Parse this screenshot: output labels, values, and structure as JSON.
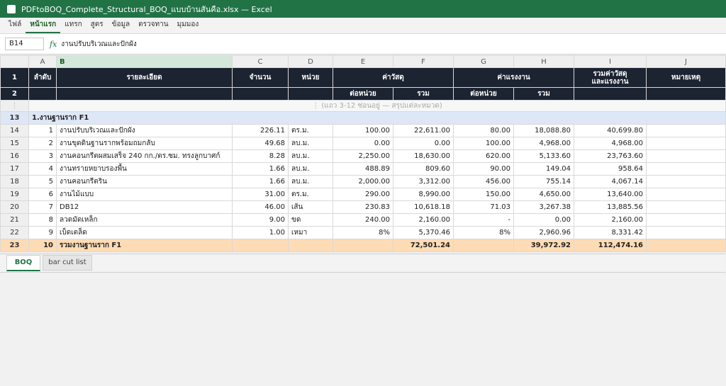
{
  "app": {
    "title": "PDFtoBOQ_Complete_Structural_BOQ_แบบบ้านสันคือ.xlsx — Excel"
  },
  "ribbon": {
    "tabs": [
      "ไฟล์",
      "หน้าแรก",
      "แทรก",
      "สูตร",
      "ข้อมูล",
      "ตรวจทาน",
      "มุมมอง"
    ]
  },
  "formula_bar": {
    "cell": "B14",
    "fx": "fx",
    "content": "งานปรับบริเวณและปักผัง"
  },
  "columns": [
    "A",
    "B",
    "C",
    "D",
    "E",
    "F",
    "G",
    "H",
    "I",
    "J"
  ],
  "header": {
    "row1": "1",
    "row2": "2",
    "a": "ลำดับ",
    "b": "รายละเอียด",
    "c": "จำนวน",
    "d": "หน่วย",
    "material": "ค่าวัสดุ",
    "labor": "ค่าแรงงาน",
    "total_l1": "รวมค่าวัสดุ",
    "total_l2": "และแรงงาน",
    "remark": "หมายเหตุ",
    "unit_price": "ต่อหน่วย",
    "sum": "รวม"
  },
  "gap": {
    "dots": "⋮",
    "note": "⋮ (แถว 3-12 ซ่อนอยู่ — สรุปแต่ละหมวด)"
  },
  "section": {
    "row": "13",
    "label": "1.งานฐานราก F1"
  },
  "rows": [
    {
      "r": "14",
      "a": "1",
      "b": "งานปรับบริเวณและปักผัง",
      "c": "226.11",
      "d": "ตร.ม.",
      "e": "100.00",
      "f": "22,611.00",
      "g": "80.00",
      "h": "18,088.80",
      "i": "40,699.80"
    },
    {
      "r": "15",
      "a": "2",
      "b": "งานขุดดินฐานรากพร้อมถมกลับ",
      "c": "49.68",
      "d": "ลบ.ม.",
      "e": "0.00",
      "f": "0.00",
      "g": "100.00",
      "h": "4,968.00",
      "i": "4,968.00"
    },
    {
      "r": "16",
      "a": "3",
      "b": "งานคอนกรีตผสมเสร็จ 240 กก./ตร.ซม. ทรงลูกบาศก์",
      "c": "8.28",
      "d": "ลบ.ม.",
      "e": "2,250.00",
      "f": "18,630.00",
      "g": "620.00",
      "h": "5,133.60",
      "i": "23,763.60"
    },
    {
      "r": "17",
      "a": "4",
      "b": "งานทรายหยาบรองพื้น",
      "c": "1.66",
      "d": "ลบ.ม.",
      "e": "488.89",
      "f": "809.60",
      "g": "90.00",
      "h": "149.04",
      "i": "958.64"
    },
    {
      "r": "18",
      "a": "5",
      "b": "งานคอนกรีตริน",
      "c": "1.66",
      "d": "ลบ.ม.",
      "e": "2,000.00",
      "f": "3,312.00",
      "g": "456.00",
      "h": "755.14",
      "i": "4,067.14"
    },
    {
      "r": "19",
      "a": "6",
      "b": "งานไม้แบบ",
      "c": "31.00",
      "d": "ตร.ม.",
      "e": "290.00",
      "f": "8,990.00",
      "g": "150.00",
      "h": "4,650.00",
      "i": "13,640.00"
    },
    {
      "r": "20",
      "a": "7",
      "b": "DB12",
      "c": "46.00",
      "d": "เส้น",
      "e": "230.83",
      "f": "10,618.18",
      "g": "71.03",
      "h": "3,267.38",
      "i": "13,885.56"
    },
    {
      "r": "21",
      "a": "8",
      "b": "ลวดมัดเหล็ก",
      "c": "9.00",
      "d": "ขด",
      "e": "240.00",
      "f": "2,160.00",
      "g": "-",
      "h": "0.00",
      "i": "2,160.00"
    },
    {
      "r": "22",
      "a": "9",
      "b": "เบ็ดเตล็ด",
      "c": "1.00",
      "d": "เหมา",
      "e": "8%",
      "f": "5,370.46",
      "g": "8%",
      "h": "2,960.96",
      "i": "8,331.42"
    }
  ],
  "total": {
    "r": "23",
    "a": "10",
    "b": "รวมงานฐานราก F1",
    "f": "72,501.24",
    "h": "39,972.92",
    "i": "112,474.16"
  },
  "sheets": [
    "BOQ",
    "bar cut list"
  ],
  "colors": {
    "accent": "#217346",
    "header_bg": "#1c2331",
    "section_bg": "#dde7f5",
    "total_bg": "#fddcb5"
  }
}
